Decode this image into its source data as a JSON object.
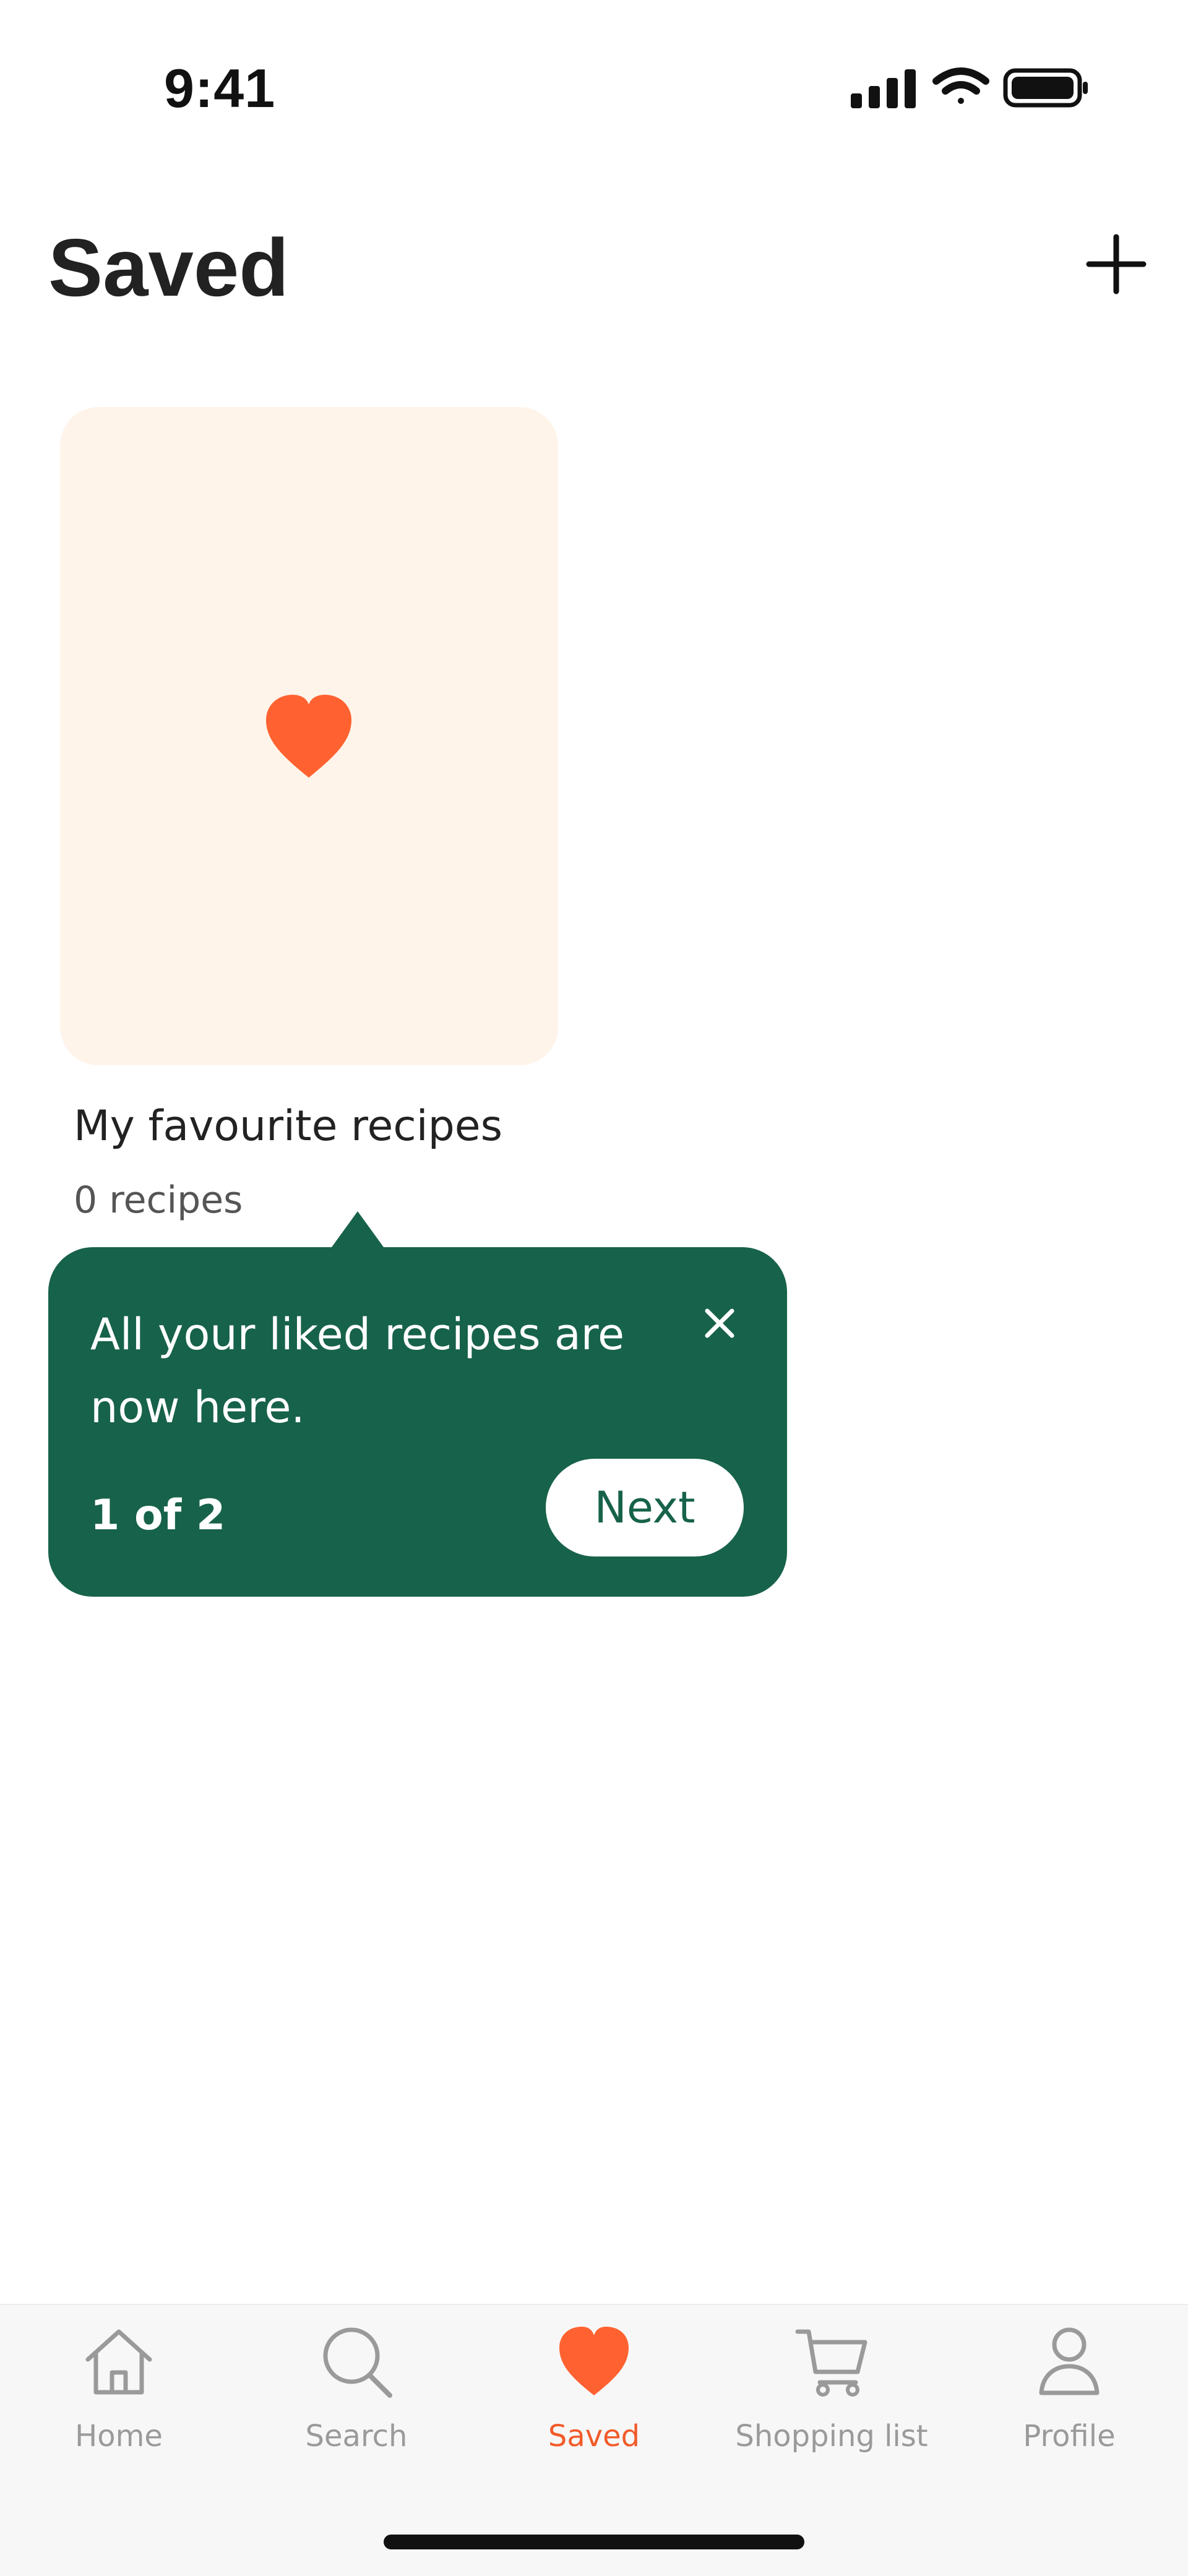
{
  "status_bar": {
    "time": "9:41",
    "icons": [
      "cellular-signal-icon",
      "wifi-icon",
      "battery-icon"
    ]
  },
  "header": {
    "title": "Saved",
    "add_icon": "plus-icon"
  },
  "collection": {
    "title": "My favourite recipes",
    "count_text": "0 recipes",
    "icon": "heart-icon",
    "card_color": "#fff4ea",
    "icon_color": "#ff6230"
  },
  "coach_mark": {
    "message": "All your liked recipes are now here.",
    "step_text": "1 of 2",
    "next_label": "Next",
    "close_icon": "close-icon",
    "background_color": "#17624a"
  },
  "tab_bar": {
    "active_color": "#f15b2a",
    "inactive_color": "#9a9a9a",
    "items": [
      {
        "label": "Home",
        "icon": "home-icon"
      },
      {
        "label": "Search",
        "icon": "search-icon"
      },
      {
        "label": "Saved",
        "icon": "heart-icon"
      },
      {
        "label": "Shopping list",
        "icon": "shopping-cart-icon"
      },
      {
        "label": "Profile",
        "icon": "profile-icon"
      }
    ]
  }
}
